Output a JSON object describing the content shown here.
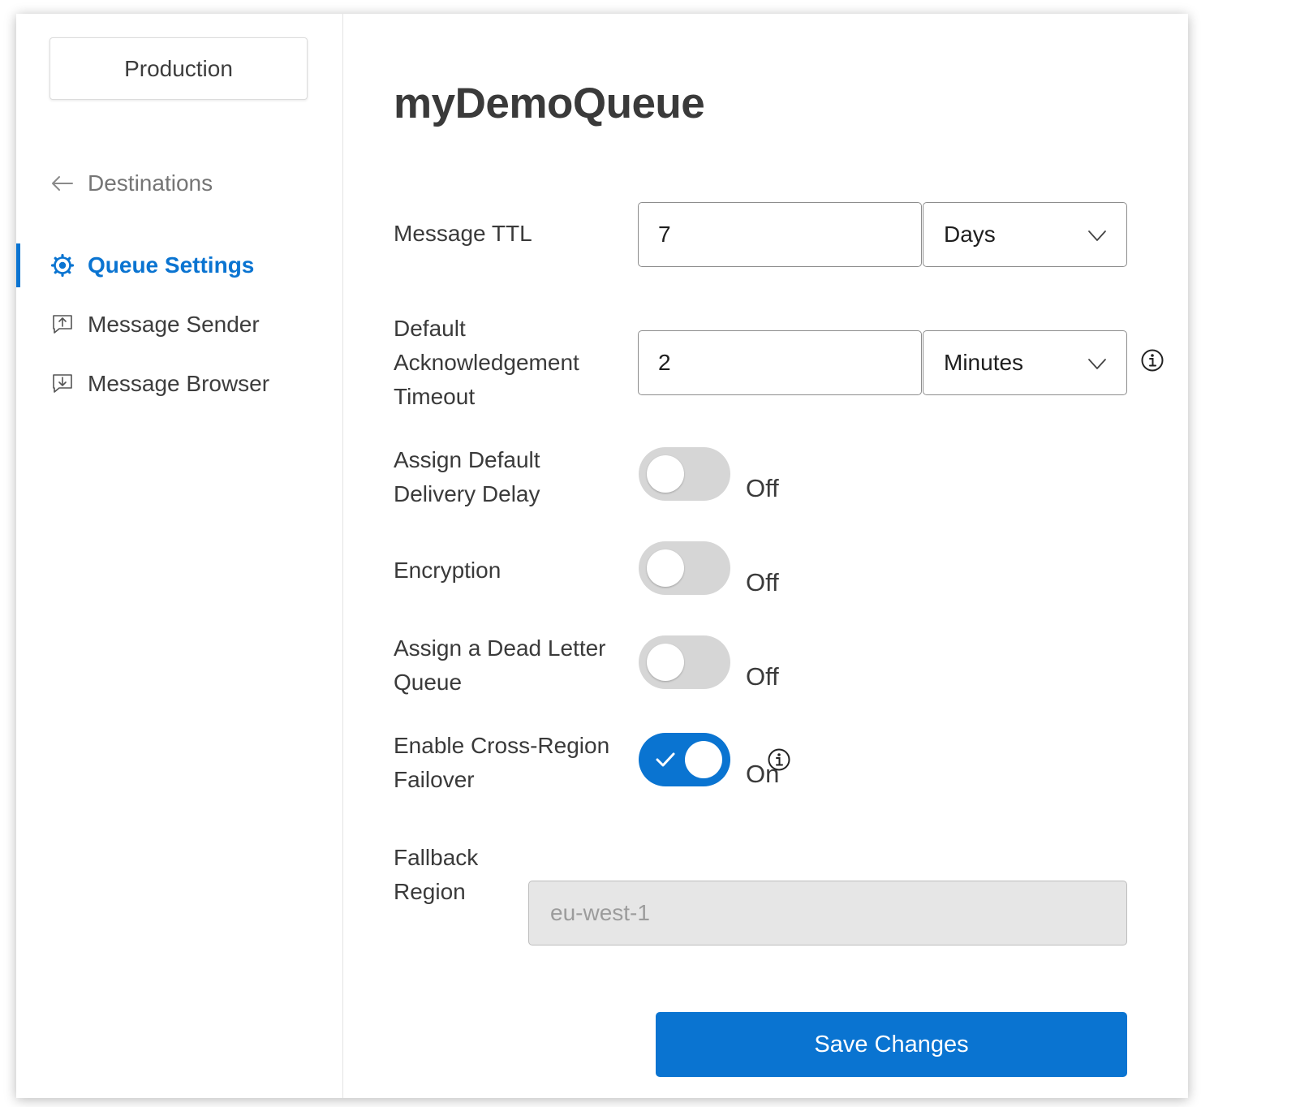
{
  "sidebar": {
    "environment_label": "Production",
    "back_link": {
      "label": "Destinations",
      "icon": "arrow-left-icon"
    },
    "items": [
      {
        "label": "Queue Settings",
        "icon": "gear-icon",
        "active": true
      },
      {
        "label": "Message Sender",
        "icon": "message-send-icon",
        "active": false
      },
      {
        "label": "Message Browser",
        "icon": "message-inbox-icon",
        "active": false
      }
    ]
  },
  "main": {
    "title": "myDemoQueue",
    "message_ttl": {
      "label": "Message TTL",
      "value": "7",
      "unit": "Days"
    },
    "ack_timeout": {
      "label_lines": [
        "Default",
        "Acknowledgement",
        "Timeout"
      ],
      "value": "2",
      "unit": "Minutes",
      "info_icon": "info-icon"
    },
    "toggles": [
      {
        "label_lines": [
          "Assign Default",
          "Delivery Delay"
        ],
        "state": "Off",
        "on": false
      },
      {
        "label_lines": [
          "Encryption"
        ],
        "state": "Off",
        "on": false
      },
      {
        "label_lines": [
          "Assign a Dead Letter",
          "Queue"
        ],
        "state": "Off",
        "on": false
      },
      {
        "label_lines": [
          "Enable Cross-Region",
          "Failover"
        ],
        "state": "On",
        "on": true,
        "info_icon": "info-icon"
      }
    ],
    "fallback_region": {
      "label_lines": [
        "Fallback",
        "Region"
      ],
      "value": "eu-west-1",
      "disabled": true
    },
    "save_label": "Save Changes"
  },
  "colors": {
    "accent": "#0a74d1",
    "toggle_off": "#d6d6d6",
    "disabled_bg": "#e6e6e6",
    "text": "#3a3a3a"
  }
}
